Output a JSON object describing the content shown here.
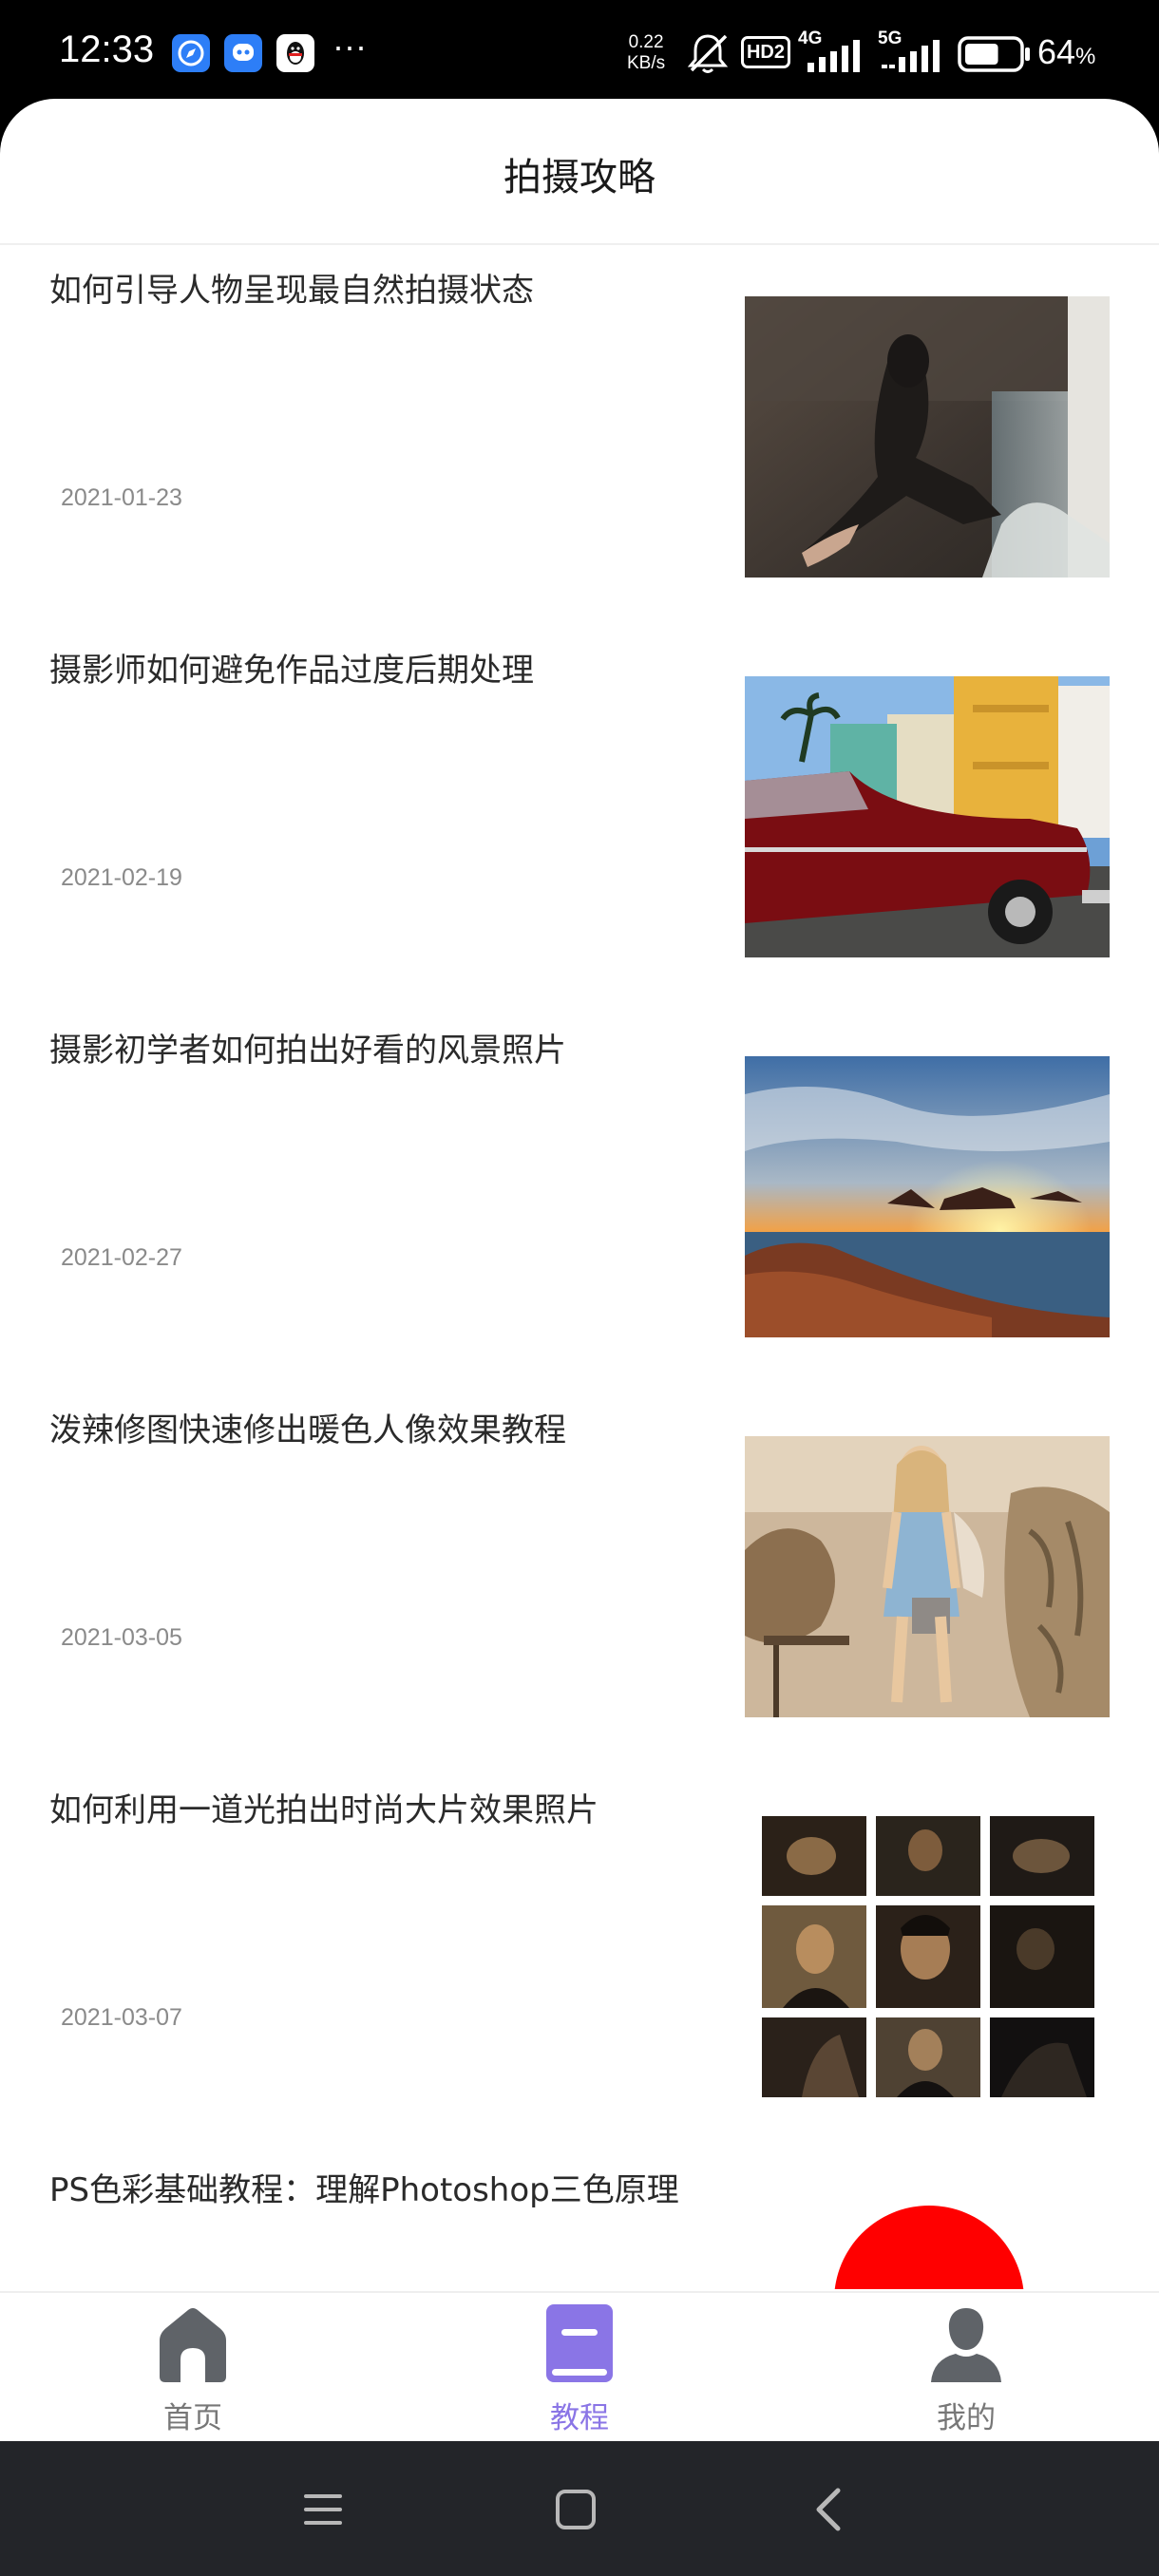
{
  "status_bar": {
    "time": "12:33",
    "more_dots": "···",
    "net_speed_value": "0.22",
    "net_speed_unit": "KB/s",
    "hd_label": "HD2",
    "signal1_label": "4G",
    "signal2_label": "5G",
    "battery_percent": "64",
    "battery_unit": "%",
    "battery_level": 0.64
  },
  "header": {
    "title": "拍摄攻略"
  },
  "articles": [
    {
      "title": "如何引导人物呈现最自然拍摄状态",
      "date": "2021-01-23"
    },
    {
      "title": "摄影师如何避免作品过度后期处理",
      "date": "2021-02-19"
    },
    {
      "title": "摄影初学者如何拍出好看的风景照片",
      "date": "2021-02-27"
    },
    {
      "title": "泼辣修图快速修出暖色人像效果教程",
      "date": "2021-03-05"
    },
    {
      "title": "如何利用一道光拍出时尚大片效果照片",
      "date": "2021-03-07"
    },
    {
      "title": "PS色彩基础教程：理解Photoshop三色原理",
      "date": ""
    }
  ],
  "bottom_nav": {
    "items": [
      {
        "label": "首页",
        "icon": "home-icon",
        "active": false
      },
      {
        "label": "教程",
        "icon": "book-icon",
        "active": true
      },
      {
        "label": "我的",
        "icon": "person-icon",
        "active": false
      }
    ],
    "active_color": "#8a75e6",
    "inactive_color": "#777777"
  },
  "system_nav": {
    "buttons": [
      "menu-icon",
      "home-square-icon",
      "back-icon"
    ]
  }
}
